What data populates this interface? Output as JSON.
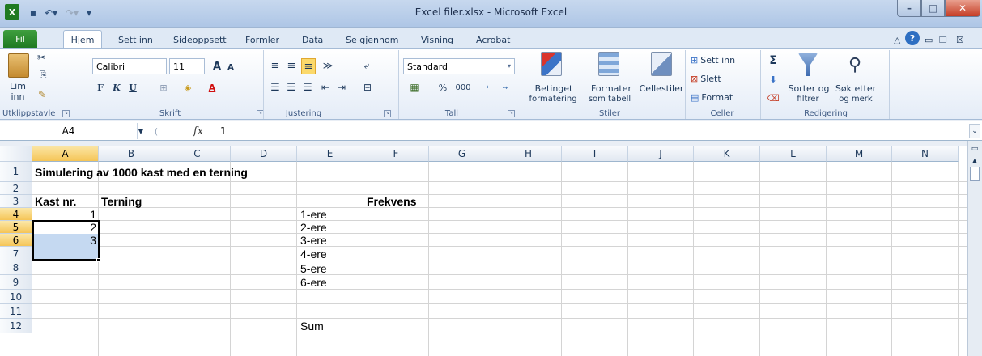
{
  "window": {
    "title": "Excel filer.xlsx - Microsoft Excel"
  },
  "tabs": [
    "Fil",
    "Hjem",
    "Sett inn",
    "Sideoppsett",
    "Formler",
    "Data",
    "Se gjennom",
    "Visning",
    "Acrobat"
  ],
  "clipboard": {
    "paste_label": "Lim",
    "paste_label2": "inn",
    "group": "Utklippstavle"
  },
  "font": {
    "name": "Calibri",
    "size": "11",
    "bold": "F",
    "italic": "K",
    "underline": "U",
    "group": "Skrift"
  },
  "alignment": {
    "group": "Justering"
  },
  "number": {
    "format": "Standard",
    "percent": "%",
    "thousands": "000",
    "inc": ",0 ,00",
    "dec": ",00 ,0",
    "group": "Tall"
  },
  "styles": {
    "conditional1": "Betinget",
    "conditional2": "formatering",
    "astable1": "Formater",
    "astable2": "som tabell",
    "cellstyles": "Cellestiler",
    "group": "Stiler"
  },
  "cells_group": {
    "insert": "Sett inn",
    "delete": "Slett",
    "format": "Format",
    "group": "Celler"
  },
  "editing": {
    "sigma": "Σ",
    "sort1": "Sorter og",
    "sort2": "filtrer",
    "find1": "Søk etter",
    "find2": "og merk",
    "group": "Redigering"
  },
  "formula_bar": {
    "name_box": "A4",
    "fx": "fx",
    "value": "1"
  },
  "columns": [
    "A",
    "B",
    "C",
    "D",
    "E",
    "F",
    "G",
    "H",
    "I",
    "J",
    "K",
    "L",
    "M",
    "N"
  ],
  "rows": [
    "1",
    "2",
    "3",
    "4",
    "5",
    "6",
    "7",
    "8",
    "9",
    "10",
    "11",
    "12"
  ],
  "sheet": {
    "title": "Simulering av 1000 kast med en terning",
    "hdr_kast": "Kast nr.",
    "hdr_terning": "Terning",
    "hdr_frekvens": "Frekvens",
    "kast": [
      "1",
      "2",
      "3"
    ],
    "labels": [
      "1-ere",
      "2-ere",
      "3-ere",
      "4-ere",
      "5-ere",
      "6-ere"
    ],
    "sum": "Sum"
  }
}
